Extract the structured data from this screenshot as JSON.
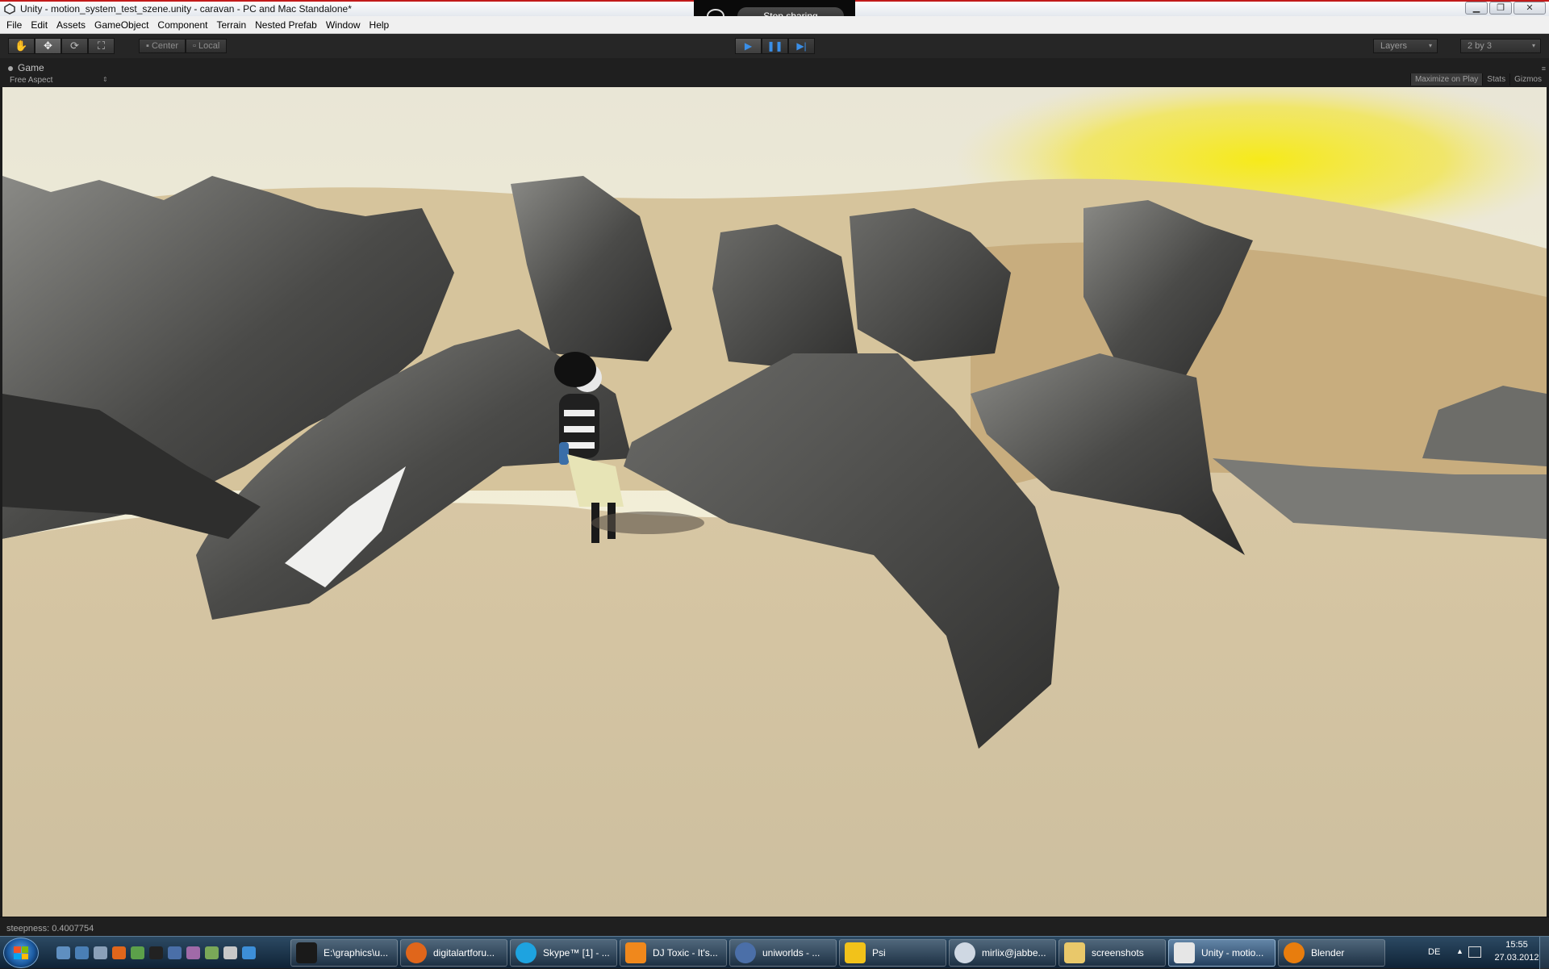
{
  "window": {
    "title": "Unity - motion_system_test_szene.unity - caravan - PC and Mac Standalone*",
    "minimize": "▁",
    "maximize": "❐",
    "close": "✕"
  },
  "share": {
    "stop_label": "Stop sharing"
  },
  "menu": [
    "File",
    "Edit",
    "Assets",
    "GameObject",
    "Component",
    "Terrain",
    "Nested Prefab",
    "Window",
    "Help"
  ],
  "toolbar": {
    "tools": [
      "hand-tool",
      "move-tool",
      "rotate-tool",
      "scale-tool"
    ],
    "pivot_center": "Center",
    "pivot_local": "Local",
    "layers_label": "Layers",
    "layout_label": "2 by 3"
  },
  "game_view": {
    "tab_label": "Game",
    "aspect_label": "Free Aspect",
    "maximize_on_play": "Maximize on Play",
    "stats": "Stats",
    "gizmos": "Gizmos"
  },
  "status": {
    "text": "steepness: 0.4007754"
  },
  "taskbar": {
    "items": [
      {
        "label": "E:\\graphics\\u...",
        "icon": "xnview-icon",
        "color": "#1a1a1a"
      },
      {
        "label": "digitalartforu...",
        "icon": "firefox-icon",
        "color": "#e0661b"
      },
      {
        "label": "Skype™ [1] - ...",
        "icon": "skype-icon",
        "color": "#1ea3e0"
      },
      {
        "label": "DJ Toxic - It's...",
        "icon": "vlc-icon",
        "color": "#f0881c"
      },
      {
        "label": "uniworlds - ...",
        "icon": "thunderbird-icon",
        "color": "#4b6fa8"
      },
      {
        "label": "Psi",
        "icon": "star-icon",
        "color": "#f2c21a"
      },
      {
        "label": "mirlix@jabbe...",
        "icon": "chat-icon",
        "color": "#cfd8e3"
      },
      {
        "label": "screenshots",
        "icon": "folder-icon",
        "color": "#e9c86a"
      },
      {
        "label": "Unity - motio...",
        "icon": "unity-icon",
        "color": "#e6e6e6",
        "active": true
      },
      {
        "label": "Blender",
        "icon": "blender-icon",
        "color": "#e87d0d"
      }
    ],
    "language": "DE",
    "time": "15:55",
    "date": "27.03.2012"
  }
}
